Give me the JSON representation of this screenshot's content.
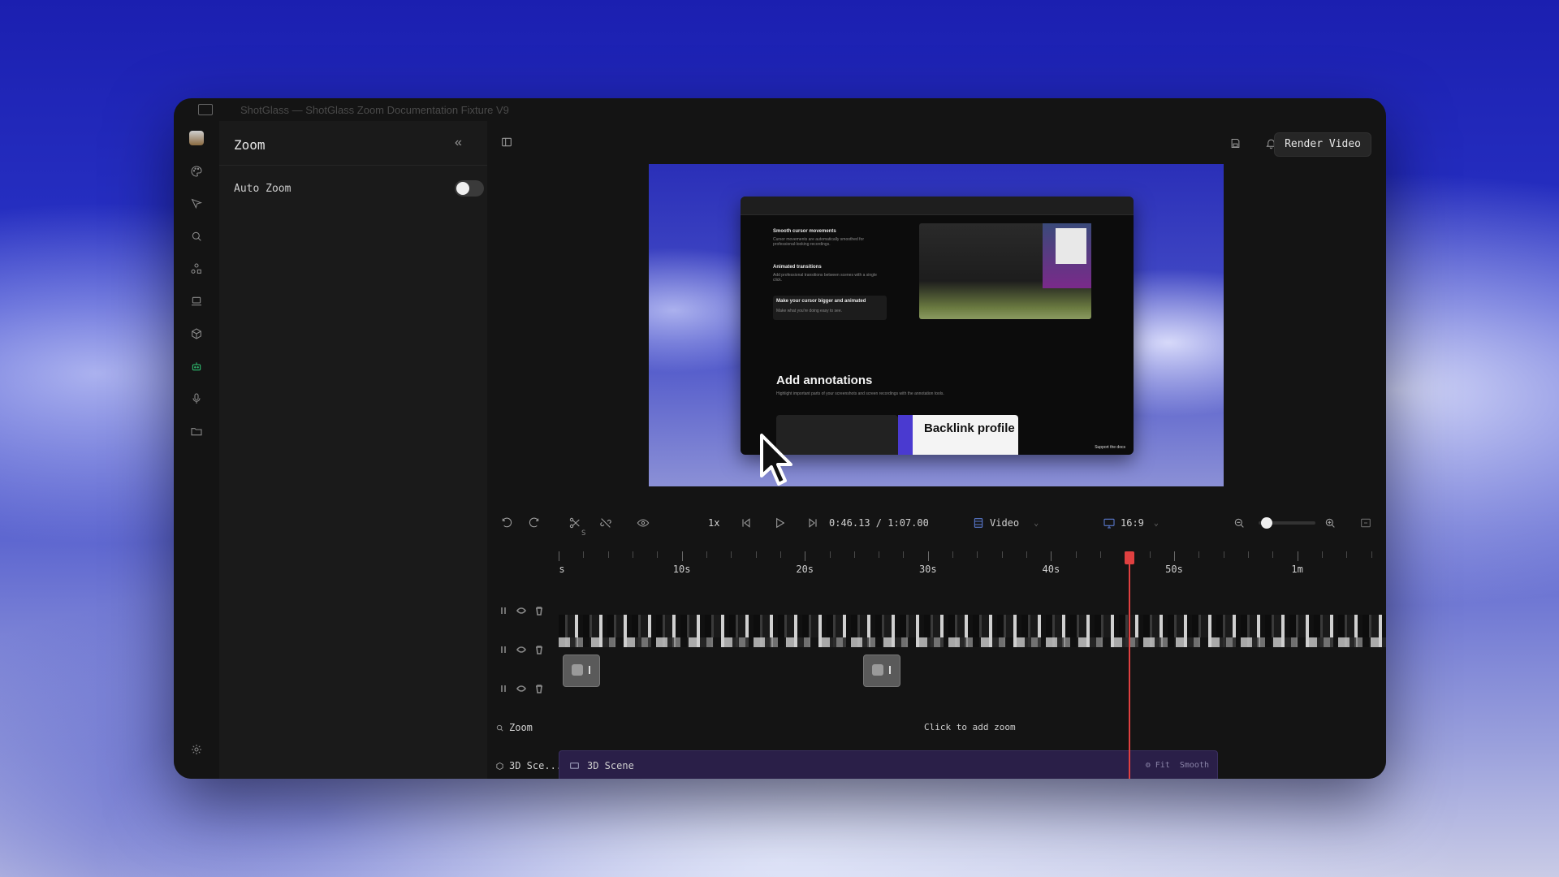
{
  "window": {
    "title": "ShotGlass — ShotGlass Zoom Documentation Fixture V9"
  },
  "sidebar": {
    "items": [
      {
        "icon": "palette-icon"
      },
      {
        "icon": "cursor-icon"
      },
      {
        "icon": "search-icon"
      },
      {
        "icon": "shapes-icon"
      },
      {
        "icon": "laptop-icon"
      },
      {
        "icon": "cube-icon"
      },
      {
        "icon": "robot-icon",
        "active": true
      },
      {
        "icon": "microphone-icon"
      },
      {
        "icon": "folder-icon"
      }
    ],
    "settings_icon": "gear-icon"
  },
  "panel": {
    "title": "Zoom",
    "collapse_glyph": "«",
    "auto_zoom": {
      "label": "Auto Zoom",
      "enabled": false
    }
  },
  "header": {
    "render_label": "Render Video"
  },
  "preview": {
    "feature1_title": "Smooth cursor movements",
    "feature1_sub": "Cursor movements are automatically smoothed for professional-looking recordings.",
    "feature2_title": "Animated transitions",
    "feature2_sub": "Add professional transitions between scenes with a single click.",
    "feature3_title": "Make your cursor bigger and animated",
    "feature3_sub": "Make what you're doing easy to see.",
    "heading": "Add annotations",
    "heading_sub": "Highlight important parts of your screenshots and screen recordings with the annotation tools.",
    "card_title": "Backlink profile",
    "support_text": "Support the docs"
  },
  "controls": {
    "speed": "1x",
    "time": "0:46.13 / 1:07.00",
    "source_label": "Video",
    "aspect_label": "16:9",
    "cut_shortcut": "S",
    "zoom_level": 0.05
  },
  "timeline": {
    "ruler": [
      "s",
      "10s",
      "20s",
      "30s",
      "40s",
      "50s",
      "1m"
    ],
    "playhead_time": "0:46.13",
    "zoom_track": {
      "name": "Zoom",
      "hint": "Click to add zoom"
    },
    "scene_track": {
      "name": "3D Sce...",
      "clip_label": "3D Scene",
      "tag_fit": "Fit",
      "tag_smooth": "Smooth"
    }
  }
}
